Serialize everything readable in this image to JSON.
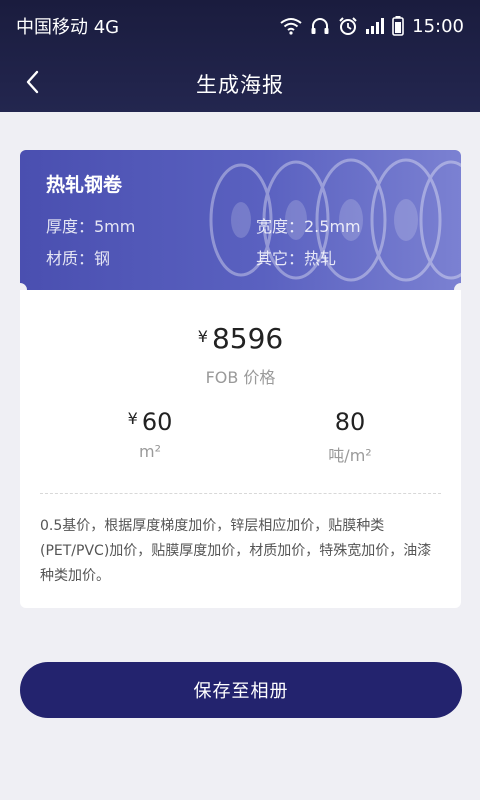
{
  "status_bar": {
    "carrier": "中国移动 4G",
    "time": "15:00",
    "icons": [
      "wifi-icon",
      "headphones-icon",
      "alarm-icon",
      "signal-icon",
      "battery-icon"
    ]
  },
  "nav": {
    "title": "生成海报",
    "back_icon": "chevron-left-icon"
  },
  "product": {
    "name": "热轧钢卷",
    "specs": {
      "thickness": "厚度：5mm",
      "width": "宽度：2.5mm",
      "material": "材质：钢",
      "other": "其它：热轧"
    }
  },
  "pricing": {
    "currency": "¥",
    "price": "8596",
    "price_label": "FOB 价格",
    "metric1_currency": "¥",
    "metric1_value": "60",
    "metric1_unit": "m²",
    "metric2_value": "80",
    "metric2_unit": "吨/m²"
  },
  "description": "0.5基价，根据厚度梯度加价，锌层相应加价，贴膜种类(PET/PVC)加价，贴膜厚度加价，材质加价，特殊宽加价，油漆种类加价。",
  "actions": {
    "save_label": "保存至相册"
  },
  "colors": {
    "header_bg": "#1c1e42",
    "card_accent": "#5158b8",
    "button_bg": "#23236e",
    "page_bg": "#efeff4"
  }
}
